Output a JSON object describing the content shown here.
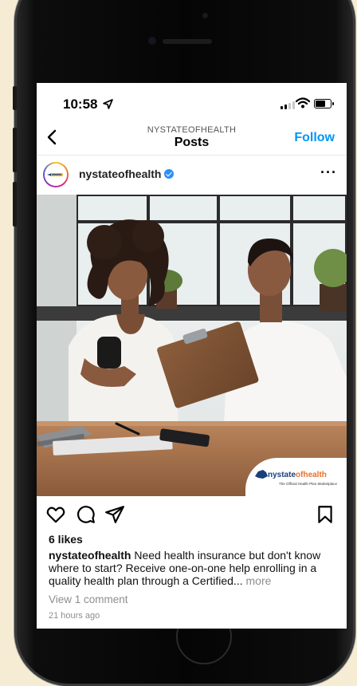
{
  "status_bar": {
    "time": "10:58",
    "battery_level": 0.8
  },
  "header": {
    "subtitle": "NYSTATEOFHEALTH",
    "title": "Posts",
    "follow_label": "Follow"
  },
  "post": {
    "username": "nystateofhealth",
    "verified": true,
    "image_logo": {
      "brand_main": "nystate",
      "brand_accent": "ofhealth",
      "tagline": "The Official Health Plan Marketplace"
    },
    "likes": "6 likes",
    "caption_user": "nystateofhealth",
    "caption_text": "Need health insurance but don't know where to start? Receive one-on-one help enrolling in a quality health plan through a Certified...",
    "caption_more": "more",
    "view_comments": "View 1 comment",
    "timestamp": "21 hours ago"
  },
  "icons": [
    "back-chevron-icon",
    "verified-badge-icon",
    "more-options-icon",
    "heart-icon",
    "comment-icon",
    "share-icon",
    "bookmark-icon"
  ],
  "colors": {
    "follow_blue": "#0095f6",
    "verified_blue": "#2e8ff7",
    "brand_blue": "#1c3f7a",
    "brand_orange": "#e8702a",
    "background": "#f6ecd3"
  }
}
